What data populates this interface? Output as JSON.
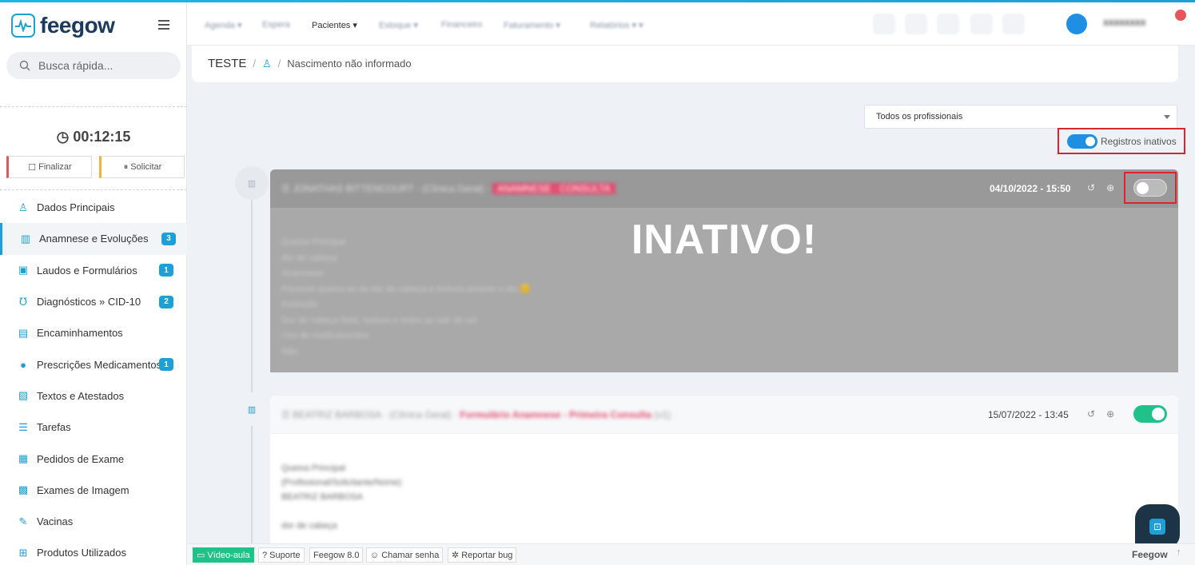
{
  "app": {
    "logo_text": "feegow"
  },
  "sidebar": {
    "search_placeholder": "Busca rápida...",
    "timer": "00:12:15",
    "finalizar_label": "Finalizar",
    "solicitar_label": "Solicitar",
    "items": [
      {
        "label": "Dados Principais",
        "icon": "user-icon",
        "badge": ""
      },
      {
        "label": "Anamnese e Evoluções",
        "icon": "chart-icon",
        "badge": "3"
      },
      {
        "label": "Laudos e Formulários",
        "icon": "clipboard-icon",
        "badge": "1"
      },
      {
        "label": "Diagnósticos » CID-10",
        "icon": "stethoscope-icon",
        "badge": "2"
      },
      {
        "label": "Encaminhamentos",
        "icon": "document-icon",
        "badge": ""
      },
      {
        "label": "Prescrições Medicamentos",
        "icon": "pills-icon",
        "badge": "1"
      },
      {
        "label": "Textos e Atestados",
        "icon": "text-doc-icon",
        "badge": ""
      },
      {
        "label": "Tarefas",
        "icon": "tasks-icon",
        "badge": ""
      },
      {
        "label": "Pedidos de Exame",
        "icon": "exam-icon",
        "badge": ""
      },
      {
        "label": "Exames de Imagem",
        "icon": "image-exam-icon",
        "badge": ""
      },
      {
        "label": "Vacinas",
        "icon": "syringe-icon",
        "badge": ""
      },
      {
        "label": "Produtos Utilizados",
        "icon": "product-icon",
        "badge": ""
      }
    ]
  },
  "topnav": {
    "pacientes_label": "Pacientes"
  },
  "breadcrumb": {
    "patient": "TESTE",
    "birth": "Nascimento não informado"
  },
  "filter": {
    "selected": "Todos os profissionais",
    "inactive_toggle_label": "Registros inativos"
  },
  "records": [
    {
      "date": "04/10/2022 - 15:50",
      "status_overlay": "INATIVO!",
      "active": false
    },
    {
      "date": "15/07/2022 - 13:45",
      "active": true
    }
  ],
  "bottombar": {
    "video": "Vídeo-aula",
    "suporte": "Suporte",
    "version": "Feegow 8.0",
    "chamar": "Chamar senha",
    "reportar": "Reportar bug",
    "brand": "Feegow"
  },
  "colors": {
    "accent": "#1e9fd6",
    "inactive_red": "#d9262c",
    "toggle_on": "#21c18a"
  }
}
